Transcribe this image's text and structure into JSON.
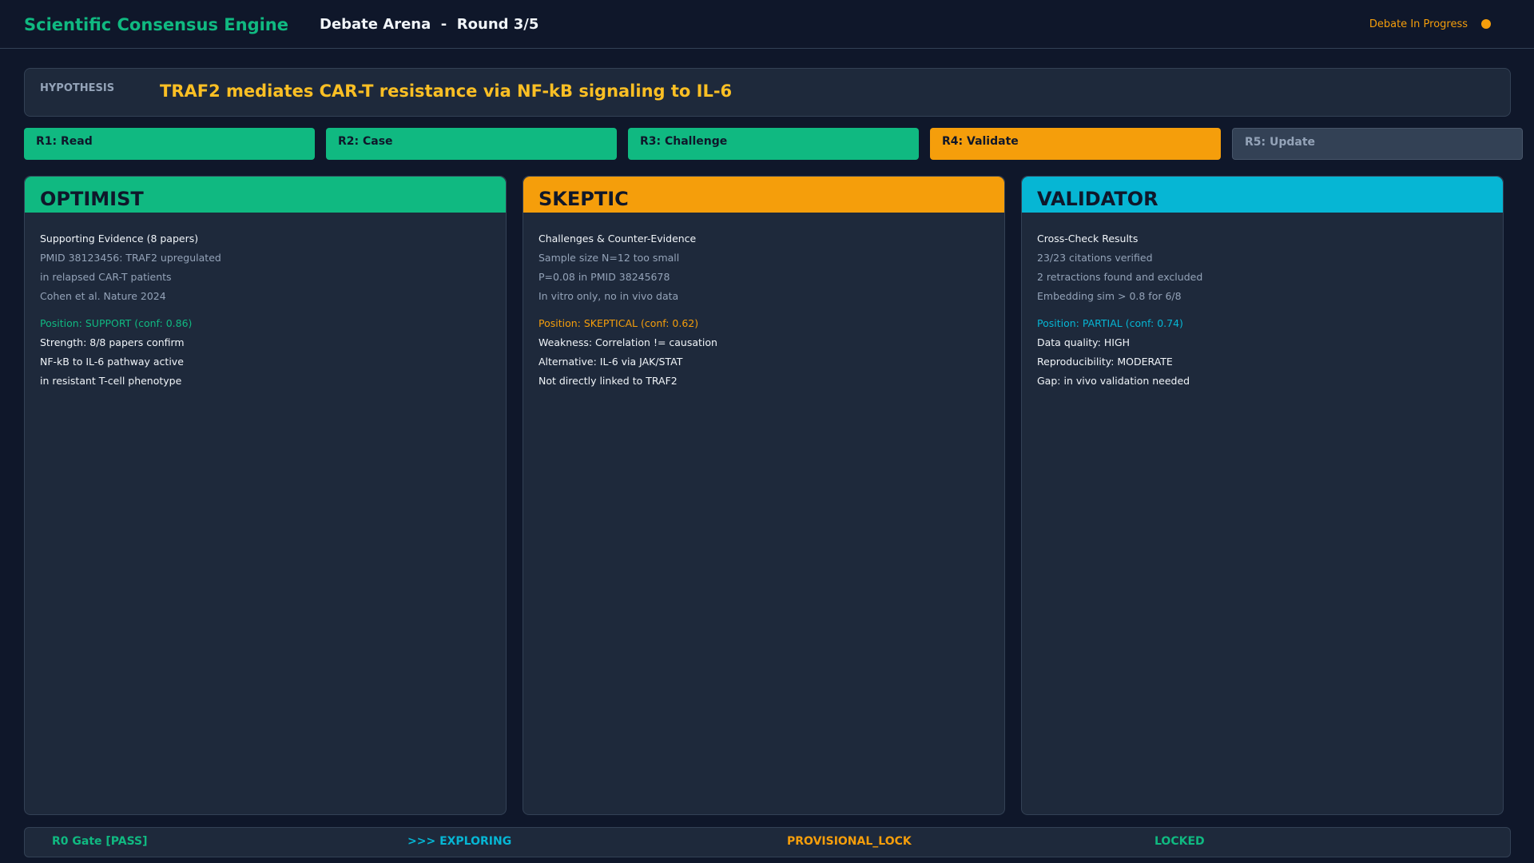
{
  "header": {
    "app_title": "Scientific Consensus Engine",
    "arena_title": "Debate Arena  -  Round 3/5",
    "status_text": "Debate In Progress",
    "status_color": "#f59e0b"
  },
  "hypothesis": {
    "label": "HYPOTHESIS",
    "text": "TRAF2 mediates CAR-T resistance via NF-kB signaling to IL-6"
  },
  "rounds": [
    {
      "label": "R1: Read",
      "state": "done"
    },
    {
      "label": "R2: Case",
      "state": "done"
    },
    {
      "label": "R3: Challenge",
      "state": "done"
    },
    {
      "label": "R4: Validate",
      "state": "active"
    },
    {
      "label": "R5: Update",
      "state": "pending"
    }
  ],
  "panels": {
    "optimist": {
      "title": "OPTIMIST",
      "color": "#10b981",
      "heading": "Supporting Evidence (8 papers)",
      "evidence": [
        "PMID 38123456: TRAF2 upregulated",
        "in relapsed CAR-T patients",
        "Cohen et al. Nature 2024"
      ],
      "position": "Position: SUPPORT (conf: 0.86)",
      "notes": [
        "Strength: 8/8 papers confirm",
        "NF-kB to IL-6 pathway active",
        "in resistant T-cell phenotype"
      ]
    },
    "skeptic": {
      "title": "SKEPTIC",
      "color": "#f59e0b",
      "heading": "Challenges & Counter-Evidence",
      "evidence": [
        "Sample size N=12 too small",
        "P=0.08 in PMID 38245678",
        "In vitro only, no in vivo data"
      ],
      "position": "Position: SKEPTICAL (conf: 0.62)",
      "notes": [
        "Weakness: Correlation != causation",
        "Alternative: IL-6 via JAK/STAT",
        "Not directly linked to TRAF2"
      ]
    },
    "validator": {
      "title": "VALIDATOR",
      "color": "#06b6d4",
      "heading": "Cross-Check Results",
      "evidence": [
        "23/23 citations verified",
        "2 retractions found and excluded",
        "Embedding sim > 0.8 for 6/8"
      ],
      "position": "Position: PARTIAL (conf: 0.74)",
      "notes": [
        "Data quality: HIGH",
        "Reproducibility: MODERATE",
        "Gap: in vivo validation needed"
      ]
    }
  },
  "footer": {
    "gate": "R0 Gate [PASS]",
    "exploring": ">>> EXPLORING",
    "provisional": "PROVISIONAL_LOCK",
    "locked": "LOCKED",
    "colors": {
      "gate": "#10b981",
      "exploring": "#06b6d4",
      "provisional": "#f59e0b",
      "locked": "#10b981"
    }
  }
}
